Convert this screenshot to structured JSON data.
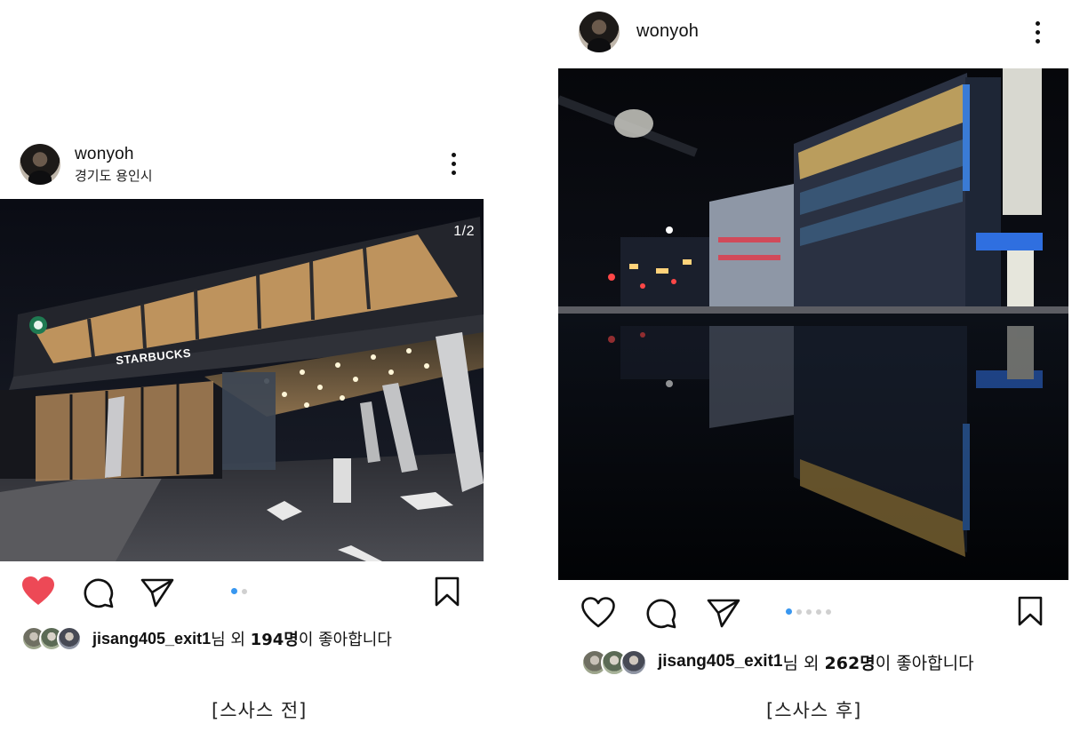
{
  "left_post": {
    "username": "wonyoh",
    "location": "경기도 용인시",
    "image_counter": "1/2",
    "storefront_sign": "STARBUCKS",
    "liked": true,
    "likes": {
      "user": "jisang405_exit1",
      "mid": "님 외 ",
      "count": "194명",
      "suffix": "이 좋아합니다"
    },
    "carousel": {
      "total": 2,
      "active": 1
    },
    "caption": "[스사스 전]"
  },
  "right_post": {
    "username": "wonyoh",
    "liked": false,
    "likes": {
      "user": "jisang405_exit1",
      "mid": "님 외 ",
      "count": "262명",
      "suffix": "이 좋아합니다"
    },
    "carousel": {
      "total": 5,
      "active": 1
    },
    "caption": "[스사스 후]"
  },
  "icons": {
    "like_filled": "heart-filled-icon",
    "like": "heart-icon",
    "comment": "comment-icon",
    "share": "send-icon",
    "save": "bookmark-icon",
    "more": "more-vertical-icon"
  },
  "colors": {
    "like_red": "#ed4956",
    "dot_active": "#3897f0",
    "dot_inactive": "#d0d0d0"
  }
}
